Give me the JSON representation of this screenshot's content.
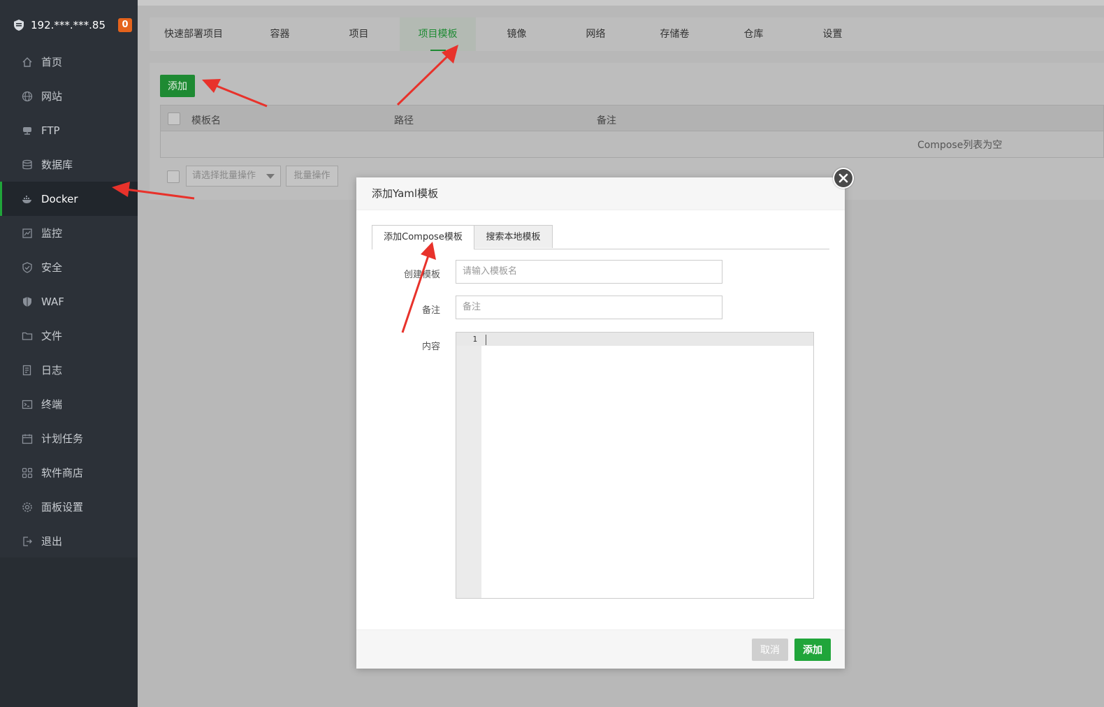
{
  "sidebar": {
    "host_ip": "192.***.***.85",
    "badge_count": "0",
    "items": [
      {
        "label": "首页",
        "icon": "home-icon"
      },
      {
        "label": "网站",
        "icon": "globe-icon"
      },
      {
        "label": "FTP",
        "icon": "ftp-icon"
      },
      {
        "label": "数据库",
        "icon": "database-icon"
      },
      {
        "label": "Docker",
        "icon": "docker-icon",
        "active": true
      },
      {
        "label": "监控",
        "icon": "monitor-icon"
      },
      {
        "label": "安全",
        "icon": "shield-check-icon"
      },
      {
        "label": "WAF",
        "icon": "waf-shield-icon"
      },
      {
        "label": "文件",
        "icon": "folder-icon"
      },
      {
        "label": "日志",
        "icon": "log-icon"
      },
      {
        "label": "终端",
        "icon": "terminal-icon"
      },
      {
        "label": "计划任务",
        "icon": "calendar-icon"
      },
      {
        "label": "软件商店",
        "icon": "apps-icon"
      },
      {
        "label": "面板设置",
        "icon": "gear-icon"
      },
      {
        "label": "退出",
        "icon": "logout-icon"
      }
    ]
  },
  "tabs": [
    "快速部署项目",
    "容器",
    "项目",
    "项目模板",
    "镜像",
    "网络",
    "存储卷",
    "仓库",
    "设置"
  ],
  "active_tab": "项目模板",
  "toolbar": {
    "add_label": "添加"
  },
  "table": {
    "headers": [
      "模板名",
      "路径",
      "备注"
    ],
    "empty_text": "Compose列表为空"
  },
  "batch": {
    "select_placeholder": "请选择批量操作",
    "button_label": "批量操作"
  },
  "modal": {
    "title": "添加Yaml模板",
    "tabs": [
      "添加Compose模板",
      "搜索本地模板"
    ],
    "fields": {
      "name_label": "创建模板",
      "name_placeholder": "请输入模板名",
      "remark_label": "备注",
      "remark_placeholder": "备注",
      "content_label": "内容"
    },
    "editor": {
      "line_number": "1"
    },
    "cancel_label": "取消",
    "confirm_label": "添加"
  },
  "colors": {
    "accent_green": "#20a53a",
    "sidebar_bg": "#2c3138",
    "badge_orange": "#e5631c",
    "arrow_red": "#e8322b"
  }
}
